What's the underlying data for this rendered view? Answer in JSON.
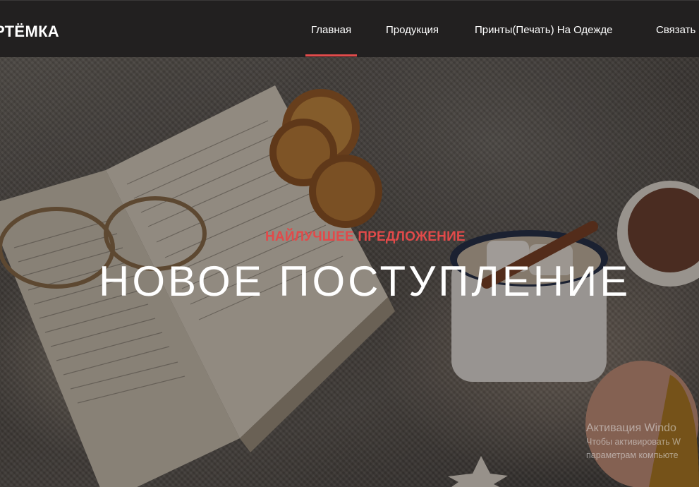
{
  "header": {
    "logo": "РТЁМКА",
    "nav": [
      {
        "label": "Главная",
        "active": true
      },
      {
        "label": "Продукция",
        "active": false
      },
      {
        "label": "Принты(Печать) На Одежде",
        "active": false
      },
      {
        "label": "Связать",
        "active": false
      }
    ]
  },
  "hero": {
    "kicker": "НАЙЛУЧШЕЕ ПРЕДЛОЖЕНИЕ",
    "title": "НОВОЕ ПОСТУПЛЕНИЕ",
    "image": "cozy-book-cocoa-photo"
  },
  "watermark": {
    "title": "Активация Windo",
    "line1": "Чтобы активировать W",
    "line2": "параметрам компьюте"
  },
  "colors": {
    "accent": "#e14b4b",
    "header_bg": "#222020",
    "text": "#ffffff"
  }
}
